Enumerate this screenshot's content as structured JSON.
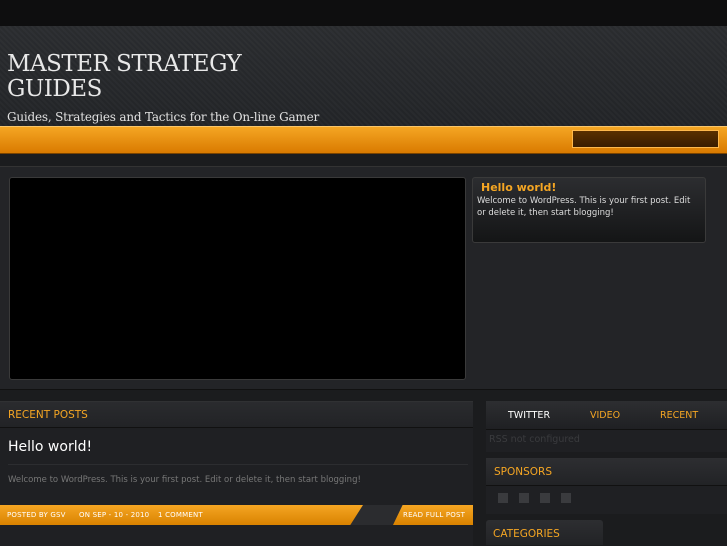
{
  "site": {
    "title": "MASTER STRATEGY GUIDES",
    "tagline": "Guides, Strategies and Tactics for the On-line Gamer"
  },
  "search": {
    "value": ""
  },
  "featured_post": {
    "title": "Hello world!",
    "excerpt": "Welcome to WordPress. This is your first post. Edit or delete it, then start blogging!"
  },
  "recent_posts": {
    "heading": "RECENT POSTS",
    "post": {
      "title": "Hello world!",
      "excerpt": "Welcome to WordPress. This is your first post. Edit or delete it, then start blogging!",
      "author_label": "POSTED BY GSV",
      "date_label": "ON SEP - 10 - 2010",
      "comments_label": "1 COMMENT",
      "read_more_label": "READ FULL POST"
    }
  },
  "sidebar": {
    "tabs": [
      {
        "label": "TWITTER",
        "active": true
      },
      {
        "label": "VIDEO",
        "active": false
      },
      {
        "label": "RECENT",
        "active": false
      }
    ],
    "rss_message": "RSS not configured",
    "sponsors_heading": "SPONSORS",
    "categories_heading": "CATEGORIES"
  },
  "colors": {
    "accent": "#f5a623",
    "background": "#1b1c1e",
    "text_light": "#ffffff"
  }
}
